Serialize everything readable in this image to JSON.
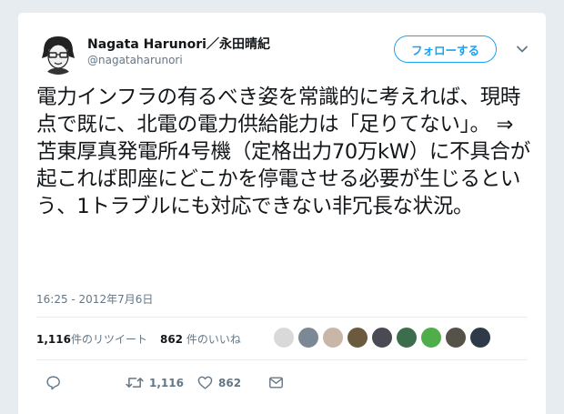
{
  "author": {
    "display_name": "Nagata Harunori／永田晴紀",
    "handle": "@nagataharunori"
  },
  "follow_button_label": "フォローする",
  "tweet": {
    "text": "電力インフラの有るべき姿を常識的に考えれば、現時点で既に、北電の電力供給能力は「足りてない」。 ⇒ 苫東厚真発電所4号機（定格出力70万kW）に不具合が起これば即座にどこかを停電させる必要が生じるという、1トラブルにも対応できない非冗長な状況。",
    "timestamp": "16:25 - 2012年7月6日"
  },
  "stats": {
    "retweet_count": "1,116",
    "retweet_label": "件のリツイート",
    "like_count": "862",
    "like_label": "件のいいね"
  },
  "liker_avatars": [
    {
      "icon": "liker-avatar-1",
      "color": "#d9d9d9"
    },
    {
      "icon": "liker-avatar-2",
      "color": "#7d8896"
    },
    {
      "icon": "liker-avatar-3",
      "color": "#c8b7a6"
    },
    {
      "icon": "liker-avatar-4",
      "color": "#6b5a3d"
    },
    {
      "icon": "liker-avatar-5",
      "color": "#4a4a55"
    },
    {
      "icon": "liker-avatar-6",
      "color": "#3c6e4d"
    },
    {
      "icon": "liker-avatar-7",
      "color": "#4fae4a"
    },
    {
      "icon": "liker-avatar-8",
      "color": "#55524a"
    },
    {
      "icon": "liker-avatar-9",
      "color": "#2f3a48"
    }
  ],
  "actions": {
    "reply_icon": "reply-icon",
    "retweet_icon": "retweet-icon",
    "retweet_count": "1,116",
    "like_icon": "heart-icon",
    "like_count": "862",
    "dm_icon": "envelope-icon"
  },
  "colors": {
    "accent": "#1da1f2",
    "secondary_text": "#657786",
    "primary_text": "#14171a",
    "background": "#e6ecf0"
  }
}
